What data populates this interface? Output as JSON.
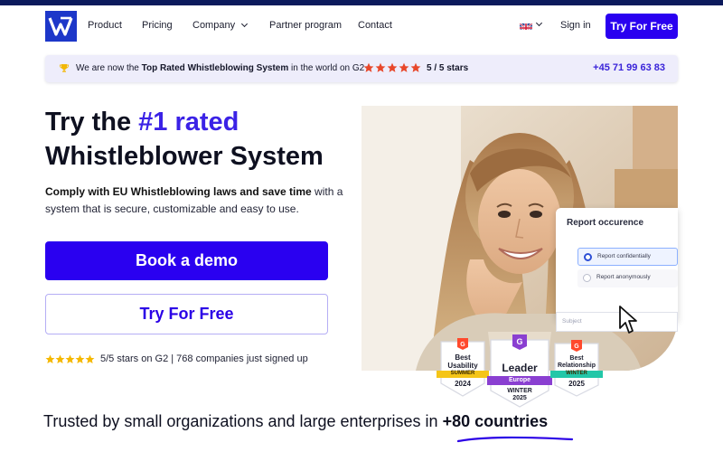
{
  "nav": {
    "items": [
      {
        "label": "Product"
      },
      {
        "label": "Pricing"
      },
      {
        "label": "Company"
      },
      {
        "label": "Partner program"
      },
      {
        "label": "Contact"
      }
    ],
    "sign_in": "Sign in",
    "cta": "Try For Free",
    "language_icon": "uk-flag-icon"
  },
  "banner": {
    "text_prefix": "We are now the ",
    "text_bold": "Top Rated Whistleblowing System",
    "text_suffix": " in the world on G2 ·",
    "rating": "5 / 5 stars",
    "stars": 5,
    "phone": "+45 71 99 63 83",
    "star_color": "#e8472a"
  },
  "hero": {
    "headline_pre": "Try the ",
    "headline_accent": "#1 rated",
    "headline_line2": "Whistleblower System",
    "sub_bold": "Comply with EU Whistleblowing laws and save time",
    "sub_rest": " with a system that is secure, customizable and easy to use.",
    "primary_button": "Book a demo",
    "secondary_button": "Try For Free",
    "rating_text": "5/5 stars on G2 | 768 companies just signed up",
    "stars": 5,
    "accent_color": "#2a00f0"
  },
  "report_card": {
    "title": "Report occurence",
    "options": [
      {
        "label": "Report confidentially",
        "selected": true
      },
      {
        "label": "Report anonymously",
        "selected": false
      }
    ],
    "subject_placeholder": "Subject"
  },
  "badges": [
    {
      "title": "Best Usability",
      "ribbon": "SUMMER",
      "year": "2024",
      "ribbon_color": "#f5c518"
    },
    {
      "title": "Leader",
      "ribbon": "Europe",
      "season": "WINTER",
      "year": "2025",
      "ribbon_color": "#8a3fd1"
    },
    {
      "title": "Best Relationship",
      "ribbon": "WINTER",
      "year": "2025",
      "ribbon_color": "#23c7a8"
    }
  ],
  "trust": {
    "text": "Trusted by small organizations and large enterprises in ",
    "emphasis": "+80 countries"
  }
}
